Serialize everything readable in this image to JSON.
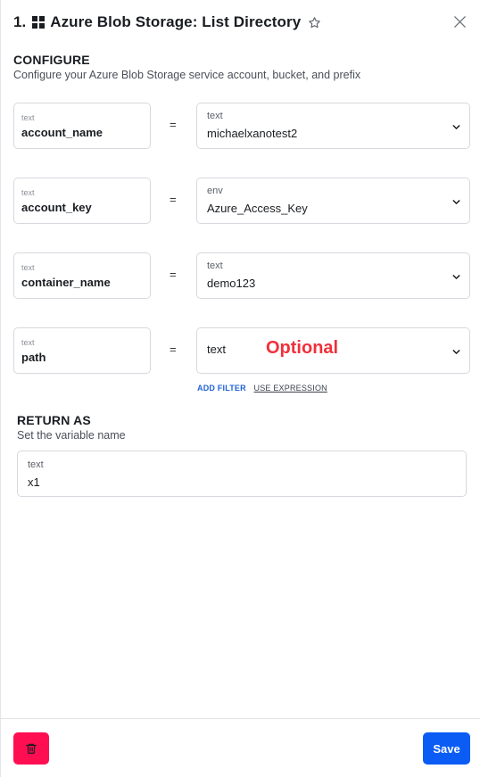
{
  "header": {
    "step_number": "1.",
    "title": "Azure Blob Storage: List Directory",
    "app_icon": "windows-grid-icon",
    "star_icon": "star-outline-icon",
    "close_icon": "close-icon"
  },
  "configure": {
    "title": "CONFIGURE",
    "subtitle": "Configure your Azure Blob Storage service account, bucket, and prefix",
    "rows": [
      {
        "left_tag": "text",
        "left_name": "account_name",
        "operator": "=",
        "right_tag": "text",
        "right_value": "michaelxanotest2"
      },
      {
        "left_tag": "text",
        "left_name": "account_key",
        "operator": "=",
        "right_tag": "env",
        "right_value": "Azure_Access_Key"
      },
      {
        "left_tag": "text",
        "left_name": "container_name",
        "operator": "=",
        "right_tag": "text",
        "right_value": "demo123"
      },
      {
        "left_tag": "text",
        "left_name": "path",
        "operator": "=",
        "right_tag": "text",
        "right_annotation": "Optional"
      }
    ],
    "add_filter": "ADD FILTER",
    "use_expression": "USE EXPRESSION"
  },
  "return_as": {
    "title": "RETURN AS",
    "subtitle": "Set the variable name",
    "tag": "text",
    "value": "x1"
  },
  "footer": {
    "delete_icon": "trash-icon",
    "save_label": "Save"
  },
  "colors": {
    "accent": "#0a5cf5",
    "danger": "#ff0f52",
    "annotation": "#f0303b",
    "link": "#1f63d6"
  }
}
